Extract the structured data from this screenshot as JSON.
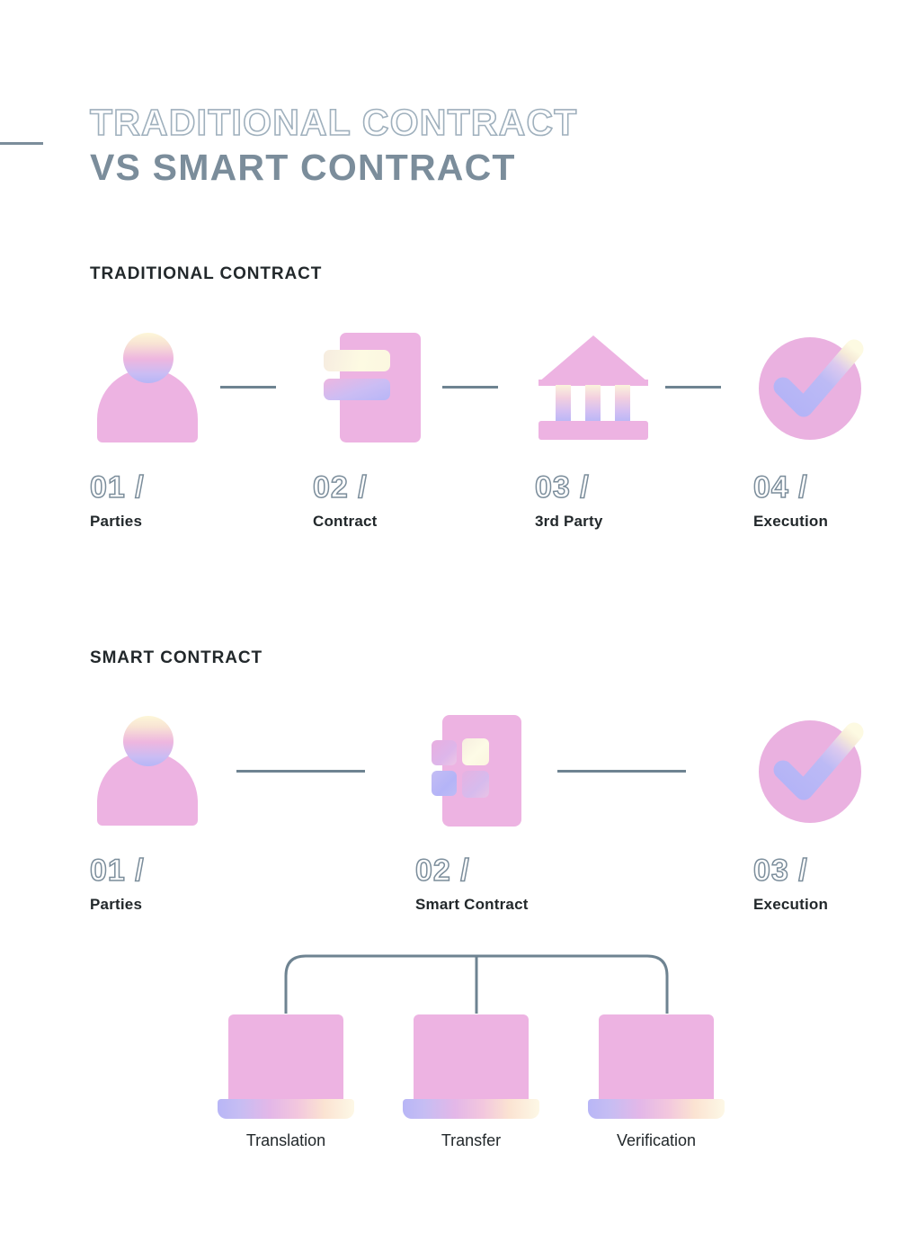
{
  "theme": {
    "pink": "#edb3e2",
    "lavender": "#b6b6f6",
    "cream": "#fdfae2",
    "slate": "#7b8d9b",
    "slate_line": "#6e8391",
    "charcoal": "#22282b",
    "background": "#ffffff"
  },
  "title": {
    "line1": "TRADITIONAL CONTRACT",
    "line2": "VS SMART CONTRACT"
  },
  "sections": [
    {
      "heading": "TRADITIONAL CONTRACT",
      "steps": [
        {
          "number": "01 /",
          "label": "Parties",
          "icon": "person-icon"
        },
        {
          "number": "02 /",
          "label": "Contract",
          "icon": "contract-document-icon"
        },
        {
          "number": "03 /",
          "label": "3rd Party",
          "icon": "bank-icon"
        },
        {
          "number": "04 /",
          "label": "Execution",
          "icon": "check-circle-icon"
        }
      ]
    },
    {
      "heading": "SMART CONTRACT",
      "steps": [
        {
          "number": "01 /",
          "label": "Parties",
          "icon": "person-icon"
        },
        {
          "number": "02 /",
          "label": "Smart Contract",
          "icon": "smart-contract-blocks-icon"
        },
        {
          "number": "03 /",
          "label": "Execution",
          "icon": "check-circle-icon"
        }
      ],
      "branches": [
        {
          "label": "Translation",
          "icon": "laptop-icon"
        },
        {
          "label": "Transfer",
          "icon": "laptop-icon"
        },
        {
          "label": "Verification",
          "icon": "laptop-icon"
        }
      ]
    }
  ]
}
